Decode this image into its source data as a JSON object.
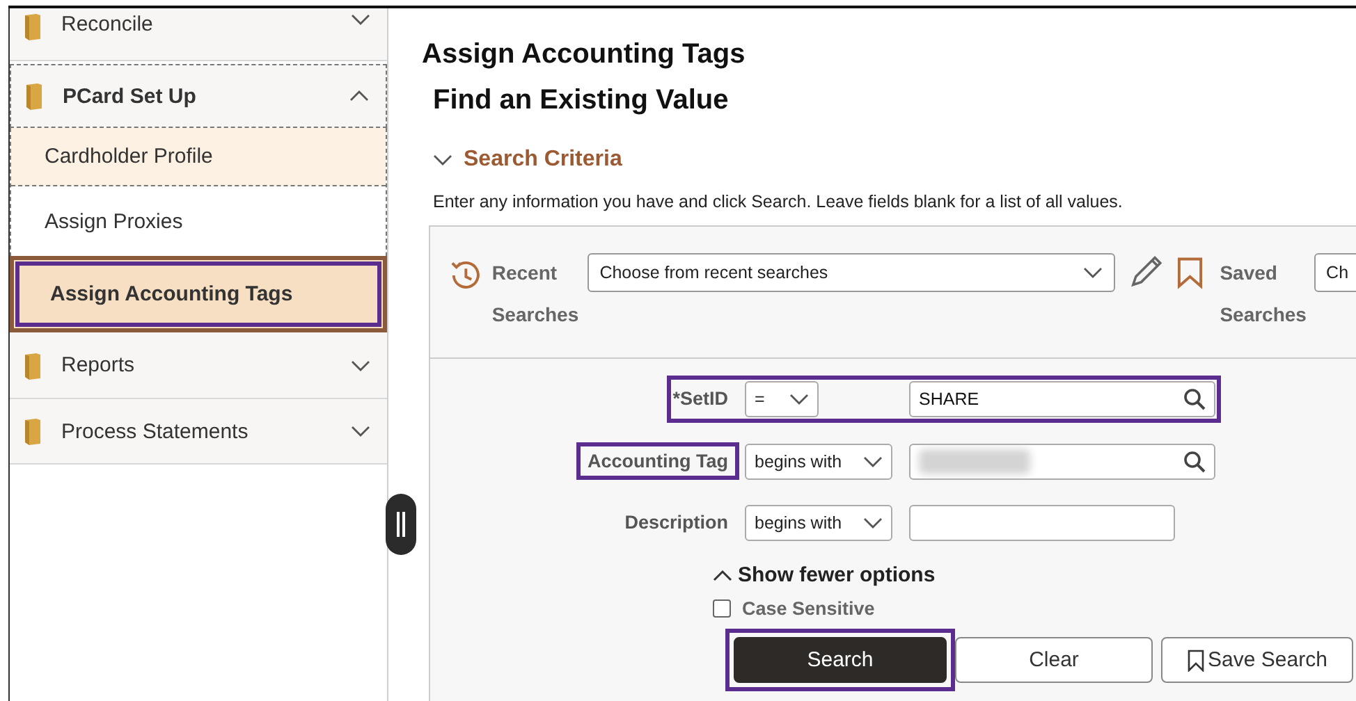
{
  "sidebar": {
    "items": [
      {
        "label": "Reconcile",
        "expanded": false
      },
      {
        "label": "PCard Set Up",
        "expanded": true,
        "children": [
          {
            "label": "Cardholder Profile",
            "hovered": true,
            "selected": false,
            "highlighted": false
          },
          {
            "label": "Assign Proxies",
            "hovered": false,
            "selected": false,
            "highlighted": false
          },
          {
            "label": "Assign Accounting Tags",
            "hovered": false,
            "selected": true,
            "highlighted": true
          }
        ]
      },
      {
        "label": "Reports",
        "expanded": false
      },
      {
        "label": "Process Statements",
        "expanded": false
      }
    ]
  },
  "title": "Assign Accounting Tags",
  "subtitle": "Find an Existing Value",
  "search_criteria": {
    "label": "Search Criteria",
    "expanded": true,
    "instructions": "Enter any information you have and click Search. Leave fields blank for a list of all values.",
    "recent": {
      "label": "Recent Searches",
      "value": "Choose from recent searches"
    },
    "saved": {
      "label": "Saved Searches",
      "value": "Ch"
    },
    "fields": [
      {
        "label": "*SetID",
        "operator": "=",
        "value": "SHARE",
        "lookup": true,
        "value_redacted": false,
        "row_highlighted": true,
        "label_highlighted": false
      },
      {
        "label": "Accounting Tag",
        "operator": "begins with",
        "lookup": true,
        "value_redacted": true,
        "row_highlighted": false,
        "label_highlighted": true
      },
      {
        "label": "Description",
        "operator": "begins with",
        "lookup": false,
        "value_redacted": false,
        "row_highlighted": false,
        "label_highlighted": false
      }
    ],
    "options_toggle": "Show fewer options",
    "case_sensitive": {
      "label": "Case Sensitive",
      "checked": false
    },
    "buttons": [
      {
        "label": "Search",
        "kind": "primary",
        "highlighted": true
      },
      {
        "label": "Clear",
        "kind": "secondary",
        "highlighted": false
      },
      {
        "label": "Save Search",
        "kind": "save",
        "highlighted": false
      }
    ]
  }
}
